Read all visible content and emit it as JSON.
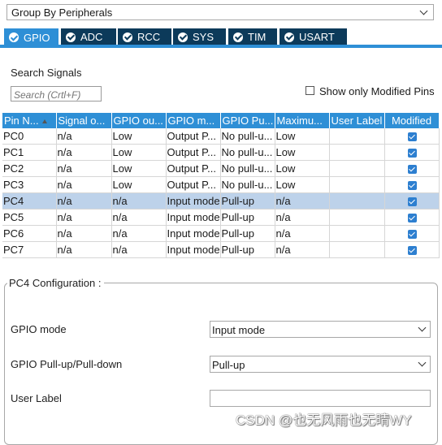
{
  "group_by": {
    "value": "Group By Peripherals"
  },
  "tabs": [
    {
      "label": "GPIO",
      "active": true
    },
    {
      "label": "ADC",
      "active": false
    },
    {
      "label": "RCC",
      "active": false
    },
    {
      "label": "SYS",
      "active": false
    },
    {
      "label": "TIM",
      "active": false
    },
    {
      "label": "USART",
      "active": false
    }
  ],
  "search": {
    "title": "Search Signals",
    "placeholder": "Search (Crtl+F)",
    "show_modified_label": "Show only Modified Pins",
    "show_modified_checked": false
  },
  "table": {
    "columns": [
      "Pin N...",
      "Signal o...",
      "GPIO ou...",
      "GPIO m...",
      "GPIO Pu...",
      "Maximu...",
      "User Label",
      "Modified"
    ],
    "rows": [
      {
        "pin": "PC0",
        "signal": "n/a",
        "output": "Low",
        "mode": "Output P...",
        "pull": "No pull-u...",
        "max": "Low",
        "label": "",
        "modified": true,
        "selected": false
      },
      {
        "pin": "PC1",
        "signal": "n/a",
        "output": "Low",
        "mode": "Output P...",
        "pull": "No pull-u...",
        "max": "Low",
        "label": "",
        "modified": true,
        "selected": false
      },
      {
        "pin": "PC2",
        "signal": "n/a",
        "output": "Low",
        "mode": "Output P...",
        "pull": "No pull-u...",
        "max": "Low",
        "label": "",
        "modified": true,
        "selected": false
      },
      {
        "pin": "PC3",
        "signal": "n/a",
        "output": "Low",
        "mode": "Output P...",
        "pull": "No pull-u...",
        "max": "Low",
        "label": "",
        "modified": true,
        "selected": false
      },
      {
        "pin": "PC4",
        "signal": "n/a",
        "output": "n/a",
        "mode": "Input mode",
        "pull": "Pull-up",
        "max": "n/a",
        "label": "",
        "modified": true,
        "selected": true
      },
      {
        "pin": "PC5",
        "signal": "n/a",
        "output": "n/a",
        "mode": "Input mode",
        "pull": "Pull-up",
        "max": "n/a",
        "label": "",
        "modified": true,
        "selected": false
      },
      {
        "pin": "PC6",
        "signal": "n/a",
        "output": "n/a",
        "mode": "Input mode",
        "pull": "Pull-up",
        "max": "n/a",
        "label": "",
        "modified": true,
        "selected": false
      },
      {
        "pin": "PC7",
        "signal": "n/a",
        "output": "n/a",
        "mode": "Input mode",
        "pull": "Pull-up",
        "max": "n/a",
        "label": "",
        "modified": true,
        "selected": false
      }
    ]
  },
  "config": {
    "title": "PC4 Configuration :",
    "gpio_mode_label": "GPIO mode",
    "gpio_mode_value": "Input mode",
    "pull_label": "GPIO Pull-up/Pull-down",
    "pull_value": "Pull-up",
    "user_label_label": "User Label",
    "user_label_value": ""
  },
  "watermark": "CSDN @也无风雨也无晴WY",
  "colors": {
    "accent": "#2e8fd6",
    "tab_dark": "#0c3a5a",
    "selected_row": "#bdd2ea",
    "checkbox": "#2d7fd0"
  }
}
